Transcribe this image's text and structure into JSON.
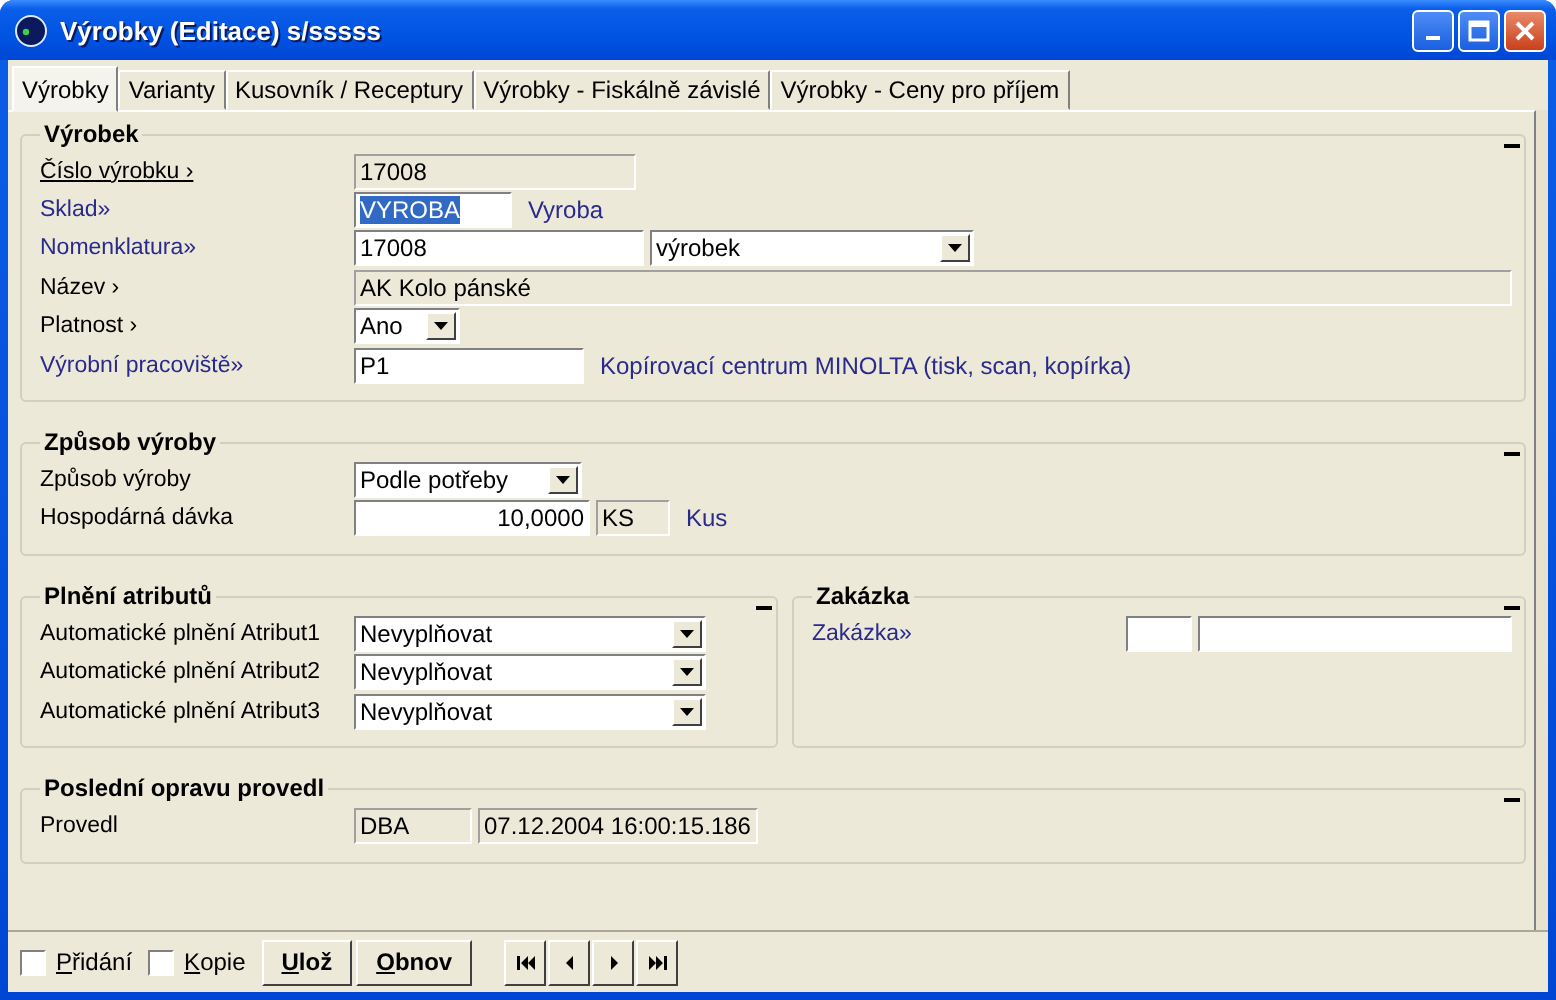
{
  "window": {
    "title": "Výrobky (Editace) s/sssss"
  },
  "tabs": [
    {
      "label": "Výrobky",
      "selected": true
    },
    {
      "label": "Varianty",
      "selected": false
    },
    {
      "label": "Kusovník / Receptury",
      "selected": false
    },
    {
      "label": "Výrobky - Fiskálně závislé",
      "selected": false
    },
    {
      "label": "Výrobky - Ceny pro příjem",
      "selected": false
    }
  ],
  "group_rows": [
    [
      {
        "title": "Výrobek",
        "fields": [
          {
            "label": "Číslo výrobku ›",
            "kind": "underlined",
            "controls": [
              {
                "kind": "field",
                "value": "17008",
                "readonly": true,
                "selected": false
              }
            ]
          },
          {
            "label": "Sklad»",
            "kind": "link",
            "controls": [
              {
                "kind": "field",
                "value": "VYROBA",
                "readonly": false,
                "selected": true
              },
              {
                "kind": "text",
                "value": "Vyroba"
              }
            ]
          },
          {
            "label": "Nomenklatura»",
            "kind": "link",
            "controls": [
              {
                "kind": "field",
                "value": "17008",
                "readonly": false,
                "selected": false
              },
              {
                "kind": "combo",
                "value": "výrobek"
              }
            ]
          },
          {
            "label": "Název ›",
            "kind": "plain",
            "controls": [
              {
                "kind": "field",
                "value": "AK Kolo pánské",
                "readonly": true,
                "selected": false
              }
            ]
          },
          {
            "label": "Platnost ›",
            "kind": "plain",
            "controls": [
              {
                "kind": "combo",
                "value": "Ano"
              }
            ]
          },
          {
            "label": "Výrobní pracoviště»",
            "kind": "link",
            "controls": [
              {
                "kind": "field",
                "value": "P1",
                "readonly": false,
                "selected": false
              },
              {
                "kind": "text",
                "value": "Kopírovací centrum MINOLTA (tisk, scan, kopírka)"
              }
            ]
          }
        ]
      }
    ],
    [
      {
        "title": "Způsob výroby",
        "fields": [
          {
            "label": "Způsob výroby",
            "kind": "plain",
            "controls": [
              {
                "kind": "combo",
                "value": "Podle potřeby"
              }
            ]
          },
          {
            "label": "Hospodárná dávka",
            "kind": "plain",
            "controls": [
              {
                "kind": "field",
                "value": "10,0000",
                "readonly": false,
                "selected": false
              },
              {
                "kind": "field",
                "value": "KS",
                "readonly": true,
                "selected": false
              },
              {
                "kind": "text",
                "value": "Kus"
              }
            ]
          }
        ]
      }
    ],
    [
      {
        "title": "Plnění atributů",
        "fields": [
          {
            "label": "Automatické plnění Atribut1",
            "kind": "plain",
            "controls": [
              {
                "kind": "combo",
                "value": "Nevyplňovat"
              }
            ]
          },
          {
            "label": "Automatické plnění Atribut2",
            "kind": "plain",
            "controls": [
              {
                "kind": "combo",
                "value": "Nevyplňovat"
              }
            ]
          },
          {
            "label": "Automatické plnění Atribut3",
            "kind": "plain",
            "controls": [
              {
                "kind": "combo",
                "value": "Nevyplňovat"
              }
            ]
          }
        ]
      },
      {
        "title": "Zakázka",
        "fields": [
          {
            "label": "Zakázka»",
            "kind": "link",
            "controls": [
              {
                "kind": "field",
                "readonly": false
              },
              {
                "kind": "field",
                "readonly": false
              }
            ]
          }
        ]
      }
    ],
    [
      {
        "title": "Poslední opravu provedl",
        "fields": [
          {
            "label": "Provedl",
            "kind": "plain",
            "controls": [
              {
                "kind": "field",
                "value": "DBA",
                "readonly": true,
                "selected": false
              },
              {
                "kind": "field",
                "value": "07.12.2004 16:00:15.186",
                "readonly": true,
                "selected": false
              }
            ]
          }
        ]
      }
    ]
  ],
  "footer": {
    "checkboxes": [
      {
        "label": "Přidání",
        "checked": false
      },
      {
        "label": "Kopie",
        "checked": false
      }
    ],
    "buttons": [
      "Ulož",
      "Obnov"
    ]
  }
}
